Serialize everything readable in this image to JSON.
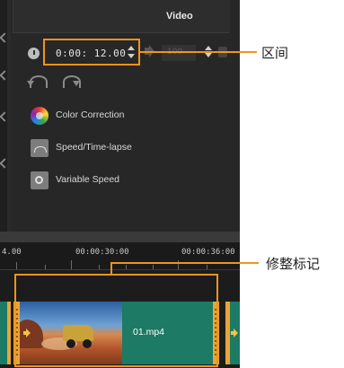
{
  "options_panel": {
    "tab_label": "Video",
    "duration_value": "0:00: 12.00",
    "volume_value": "100",
    "items": [
      {
        "label": "Color Correction",
        "icon": "color-correction-icon"
      },
      {
        "label": "Speed/Time-lapse",
        "icon": "speed-timelapse-icon"
      },
      {
        "label": "Variable Speed",
        "icon": "variable-speed-icon"
      }
    ]
  },
  "timeline": {
    "ruler_ticks": [
      "4.00",
      "00:00:30:00",
      "00:00:36:00"
    ],
    "clip_name": "01.mp4"
  },
  "annotations": {
    "duration_label": "区间",
    "trim_marker_label": "修整标记"
  },
  "colors": {
    "highlight": "#f0941e",
    "clip_fill": "#1d7a64",
    "trim_handle": "#e8a43a",
    "panel_bg": "#272727"
  }
}
